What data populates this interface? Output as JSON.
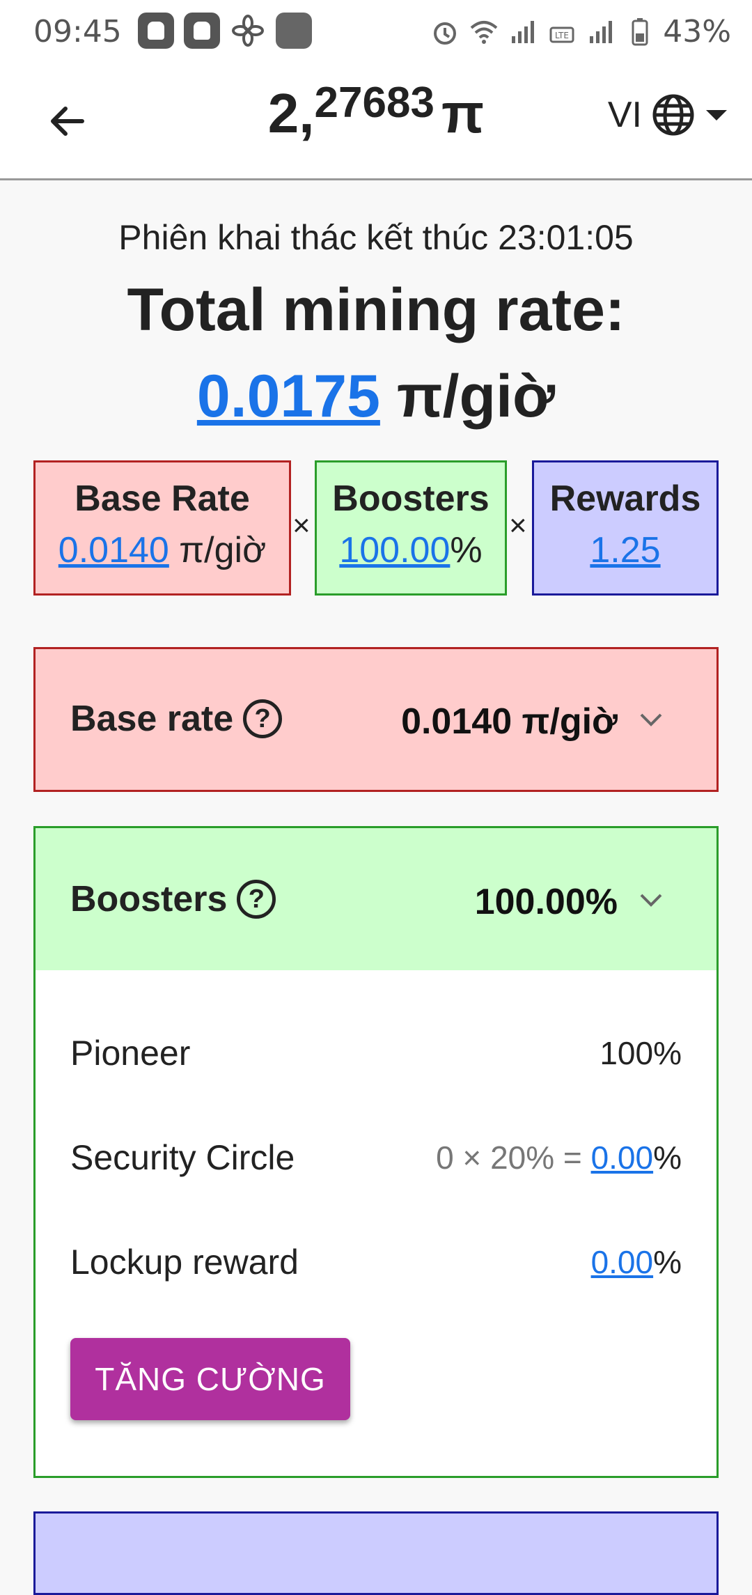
{
  "status_bar": {
    "time": "09:45",
    "battery": "43%",
    "left_icons": [
      "app-icon",
      "app-icon",
      "fan-icon",
      "gallery-icon"
    ],
    "right_icons": [
      "alarm-icon",
      "wifi-icon",
      "signal-icon",
      "volte-icon",
      "signal-icon",
      "battery-icon"
    ]
  },
  "header": {
    "balance_int": "2,",
    "balance_frac": "27683",
    "balance_unit": "π",
    "language": "VI"
  },
  "summary": {
    "session_text": "Phiên khai thác kết thúc 23:01:05",
    "title": "Total mining rate:",
    "rate": "0.0175",
    "rate_unit": "π/giờ"
  },
  "boxes": {
    "base": {
      "title": "Base Rate",
      "value": "0.0140",
      "unit": "π/giờ"
    },
    "boosters": {
      "title": "Boosters",
      "value": "100.00",
      "unit": "%"
    },
    "rewards": {
      "title": "Rewards",
      "value": "1.25"
    },
    "times_symbol": "×"
  },
  "base_panel": {
    "label": "Base rate",
    "value": "0.0140 π/giờ"
  },
  "boosters_panel": {
    "label": "Boosters",
    "value": "100.00%",
    "items": [
      {
        "label": "Pioneer",
        "value": "100%"
      },
      {
        "label": "Security Circle",
        "formula": "0 × 20% = ",
        "value": "0.00",
        "unit": "%"
      },
      {
        "label": "Lockup reward",
        "value": "0.00",
        "unit": "%"
      }
    ],
    "button_label": "TĂNG CƯỜNG"
  },
  "colors": {
    "base_bg": "#ffcccc",
    "base_border": "#b22222",
    "boost_bg": "#ccffcc",
    "boost_border": "#2a9d2a",
    "rewards_bg": "#ccccff",
    "rewards_border": "#1a1a9a",
    "link": "#1a73e8",
    "button": "#b0309e"
  }
}
